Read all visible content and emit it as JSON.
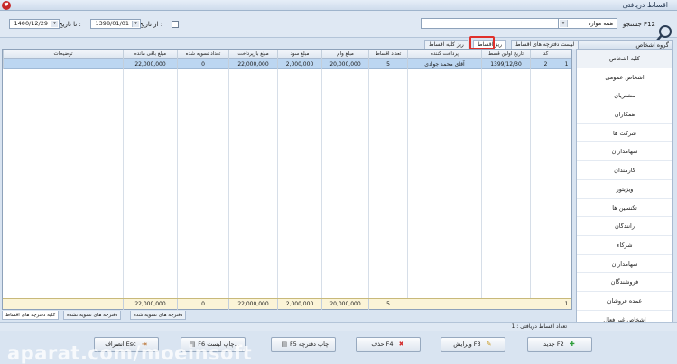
{
  "window": {
    "title": "اقساط دریافتی"
  },
  "toolbar": {
    "from_date_label": "از تاریخ :",
    "from_date": "1398/01/01",
    "to_date_label": "تا تاریخ :",
    "to_date": "1400/12/29",
    "search_label": "جستجو F12",
    "search_scope": "همه موارد",
    "search_value": ""
  },
  "right_panel": {
    "header": "گروه اشخاص",
    "items": [
      "کلیه اشخاص",
      "اشخاص عمومی",
      "مشتریان",
      "همکاران",
      "شرکت ها",
      "سهامداران",
      "کارمندان",
      "ویزیتور",
      "تکنسین ها",
      "رانندگان",
      "شرکاء",
      "سهامداران",
      "فروشندگان",
      "عمده فروشان",
      "اشخاص غیر فعال"
    ]
  },
  "tabs_top": [
    "لیست دفترچه های اقساط",
    "ریز اقساط",
    "ریز کلیه اقساط"
  ],
  "grid": {
    "columns": [
      "کد",
      "تاریخ اولین قسط",
      "پرداخت کننده",
      "تعداد اقساط",
      "مبلغ وام",
      "مبلغ سود",
      "مبلغ بازپرداخت",
      "تعداد تسویه شده",
      "مبلغ باقی مانده",
      "توضیحات"
    ],
    "rows": [
      {
        "index": "1",
        "code": "2",
        "first_date": "1399/12/30",
        "payer": "آقای محمد جوادی",
        "count": "5",
        "loan": "20,000,000",
        "profit": "2,000,000",
        "repayment": "22,000,000",
        "settled": "0",
        "remaining": "22,000,000",
        "desc": ""
      }
    ],
    "footer": {
      "index": "1",
      "count": "5",
      "loan": "20,000,000",
      "profit": "2,000,000",
      "repayment": "22,000,000",
      "settled": "0",
      "remaining": "22,000,000"
    }
  },
  "tabs_bottom": [
    "دفترچه های تسویه شده",
    "دفترچه های تسویه نشده",
    "کلیه دفترچه های اقساط"
  ],
  "status": {
    "text": "تعداد اقساط دریافتی : 1"
  },
  "buttons": {
    "new": "جدید F2",
    "edit": "ویرایش F3",
    "delete": "حذف F4",
    "print_book": "F5 چاپ دفترچه",
    "print_list": "F6 چاپ لیست...",
    "cancel": "انصراف Esc"
  },
  "watermark": "aparat.com/moeinsoft",
  "colors": {
    "selected_row": "#bcd6f1",
    "footer_row": "#fbf4d7",
    "highlight": "#e0302b"
  }
}
